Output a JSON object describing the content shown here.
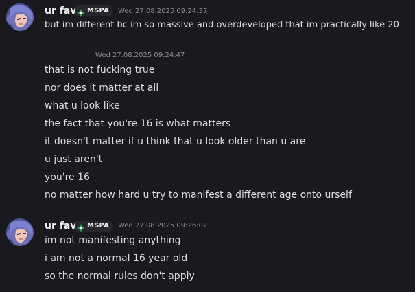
{
  "group1": {
    "username": "ur fav",
    "tag": "MSPA",
    "timestamp": "Wed 27.08.2025 09:24:37",
    "messages": [
      "but im different bc im so massive and overdeveloped that im practically like 20"
    ]
  },
  "group2": {
    "timestamp": "Wed 27.08.2025 09:24:47",
    "messages": [
      "that is not fucking true",
      "nor does it matter at all",
      "what u look like",
      "the fact that you're 16 is what matters",
      "it doesn't matter if u think that u look older than u are",
      "u just aren't",
      "you're 16",
      "no matter how hard u try to manifest a different age onto urself"
    ]
  },
  "group3": {
    "username": "ur fav",
    "tag": "MSPA",
    "timestamp": "Wed 27.08.2025 09:26:02",
    "messages": [
      "im not manifesting anything",
      "i am not a normal 16 year old",
      "so the normal rules don't apply"
    ]
  },
  "colors": {
    "background": "#1a1a1e",
    "username": "#f2f3f5",
    "message_text": "#dbdee1",
    "timestamp": "#8a8d93",
    "tag_background": "#27272d",
    "tag_icon": "#3ba55c"
  },
  "icons": {
    "avatar": "avatar",
    "tag_icon": "green-diamond-icon"
  }
}
